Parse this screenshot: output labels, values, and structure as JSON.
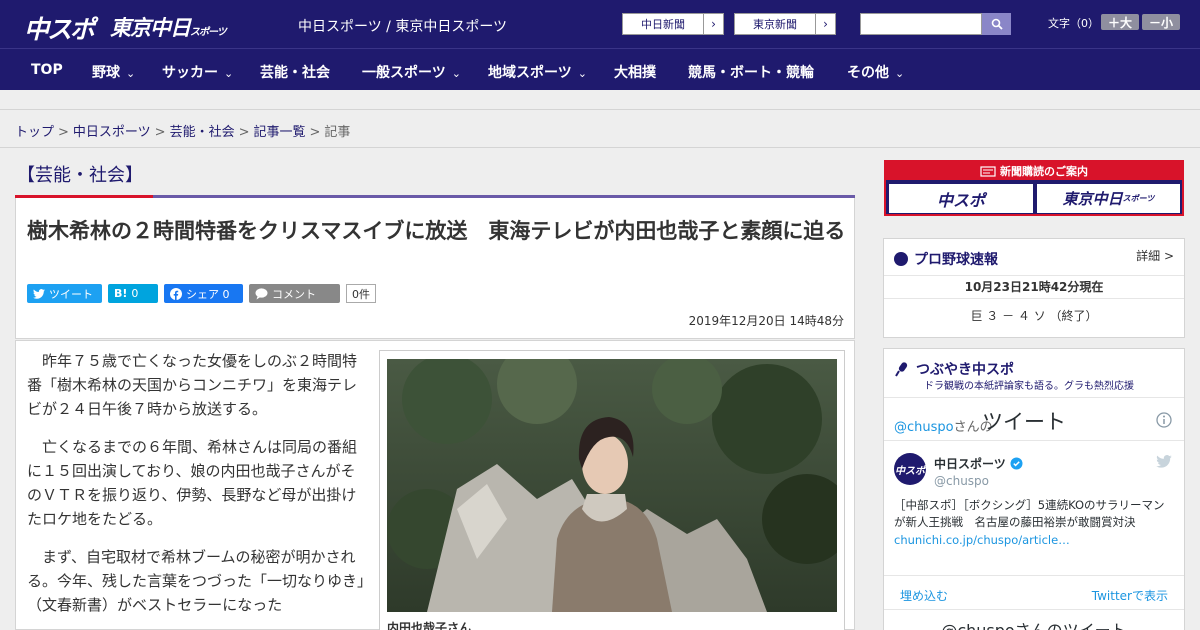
{
  "header": {
    "logo_primary": "中スポ",
    "logo_secondary": "東京中日",
    "logo_secondary_small": "スポーツ",
    "site_name": "中日スポーツ / 東京中日スポーツ",
    "paper_links": [
      {
        "label": "中日新聞",
        "arrow": "›"
      },
      {
        "label": "東京新聞",
        "arrow": "›"
      }
    ],
    "search_placeholder": "",
    "font_size_label": "文字（0）",
    "font_up": "＋大",
    "font_down": "－小"
  },
  "nav": {
    "items": [
      {
        "label": "TOP",
        "has_menu": false
      },
      {
        "label": "野球",
        "has_menu": true
      },
      {
        "label": "サッカー",
        "has_menu": true
      },
      {
        "label": "芸能・社会",
        "has_menu": false
      },
      {
        "label": "一般スポーツ",
        "has_menu": true
      },
      {
        "label": "地域スポーツ",
        "has_menu": true
      },
      {
        "label": "大相撲",
        "has_menu": false
      },
      {
        "label": "競馬・ボート・競輪",
        "has_menu": false
      },
      {
        "label": "その他",
        "has_menu": true
      }
    ],
    "chevron": "⌄"
  },
  "breadcrumb": {
    "items": [
      "トップ",
      "中日スポーツ",
      "芸能・社会",
      "記事一覧"
    ],
    "current": "記事",
    "separator": ">"
  },
  "article": {
    "category": "【芸能・社会】",
    "headline": "樹木希林の２時間特番をクリスマスイブに放送　東海テレビが内田也哉子と素顔に迫る",
    "share": {
      "tweet": "ツイート",
      "hatena_label": "B!",
      "hatena_count": "0",
      "facebook": "シェア 0",
      "comment": "コメント",
      "comment_count": "0件"
    },
    "date": "2019年12月20日 14時48分",
    "paragraphs": [
      "昨年７５歳で亡くなった女優をしのぶ２時間特番「樹木希林の天国からコンニチワ」を東海テレビが２４日午後７時から放送する。",
      "亡くなるまでの６年間、希林さんは同局の番組に１５回出演しており、娘の内田也哉子さんがそのＶＴＲを振り返り、伊勢、長野など母が出掛けたロケ地をたどる。",
      "まず、自宅取材で希林ブームの秘密が明かされる。今年、残した言葉をつづった「一切なりゆき」（文春新書）がベストセラーになった"
    ],
    "photo_caption": "内田也哉子さん"
  },
  "sidebar": {
    "ad": {
      "header": "新聞購読のご案内",
      "logo_left": "中スポ",
      "logo_right": "東京中日",
      "logo_right_small": "スポーツ"
    },
    "baseball": {
      "title": "プロ野球速報",
      "more": "詳細 >",
      "updated": "10月23日21時42分現在",
      "score": "巨 ３ － ４ ソ （終了）"
    },
    "tweets": {
      "title": "つぶやき中スポ",
      "subtitle": "ドラ観戦の本紙評論家も語る。グラも熱烈応援",
      "handle_prefix": "@chuspo",
      "handle_suffix": "さんの",
      "heading": "ツイート",
      "tweet_name": "中日スポーツ",
      "tweet_handle": "@chuspo",
      "tweet_text": "［中部スポ］［ボクシング］5連続KOのサラリーマンが新人王挑戦　名古屋の藤田裕崇が敢闘賞対決",
      "tweet_link": "chunichi.co.jp/chuspo/article…",
      "embed": "埋め込む",
      "view_on_twitter": "Twitterで表示",
      "footer": "@chuspoさんのツイート"
    }
  },
  "colors": {
    "brand": "#1f1a6e",
    "accent_red": "#d8132a",
    "twitter": "#1da1f2",
    "hatena": "#00a4de",
    "facebook": "#1877f2",
    "comment": "#888888"
  }
}
